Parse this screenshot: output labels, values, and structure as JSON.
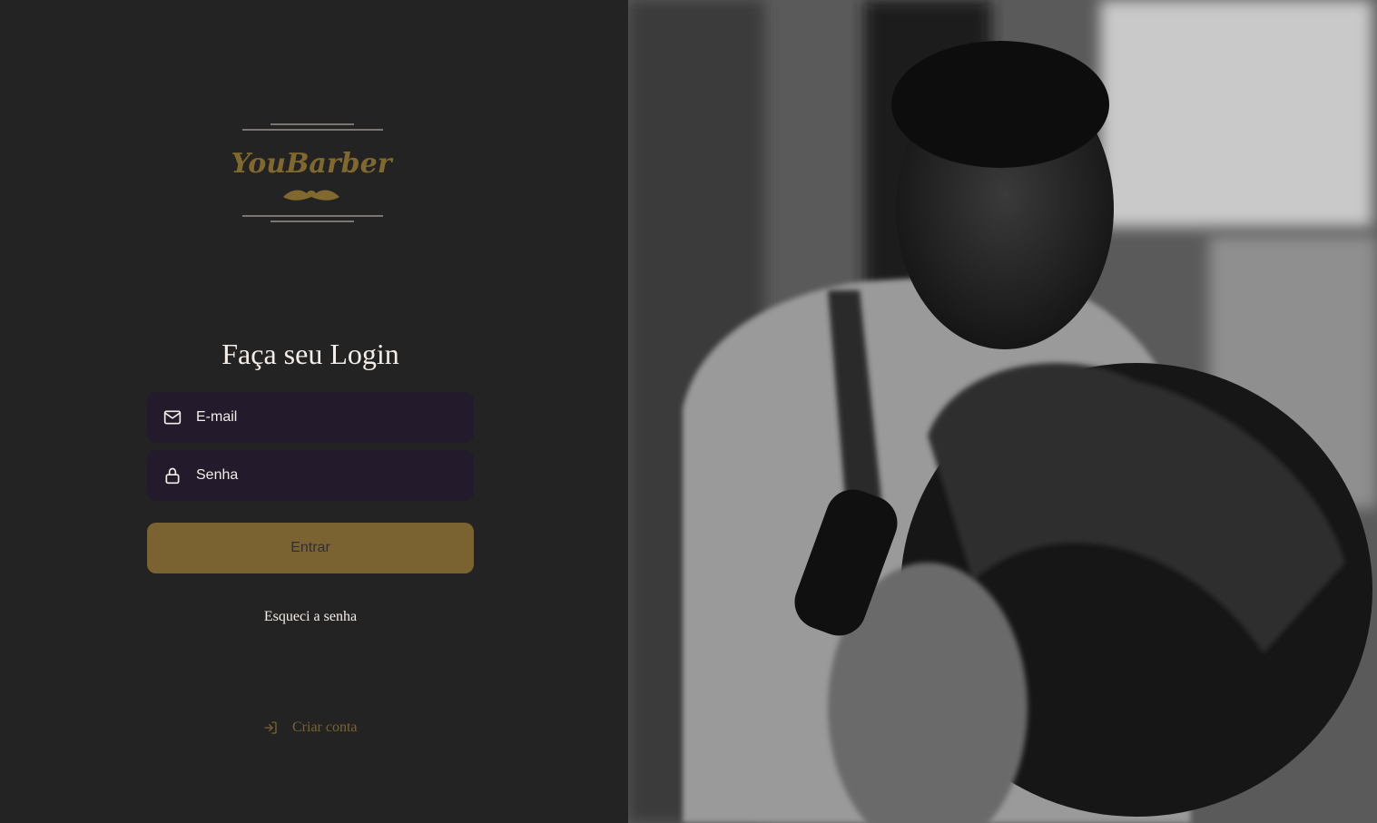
{
  "brand": {
    "name": "YouBarber",
    "accent_color": "#7a6330"
  },
  "login": {
    "title": "Faça seu Login",
    "email_placeholder": "E-mail",
    "email_icon": "mail-icon",
    "password_placeholder": "Senha",
    "password_icon": "lock-icon",
    "submit_label": "Entrar",
    "forgot_label": "Esqueci a senha",
    "create_account_label": "Criar conta",
    "create_account_icon": "log-in-icon"
  },
  "background": {
    "image": "barber-photo"
  }
}
